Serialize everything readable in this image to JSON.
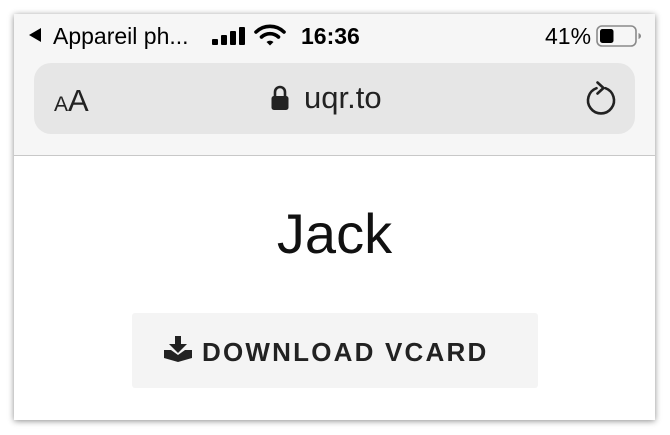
{
  "status_bar": {
    "carrier": "Appareil ph...",
    "time": "16:36",
    "battery_percent": "41%",
    "battery_level": 0.41
  },
  "browser": {
    "text_size_small": "A",
    "text_size_large": "A",
    "domain": "uqr.to"
  },
  "page": {
    "name": "Jack",
    "download_label": "DOWNLOAD VCARD"
  },
  "icons": {
    "back": "back-arrow-icon",
    "signal": "cellular-signal-icon",
    "wifi": "wifi-icon",
    "battery": "battery-icon",
    "lock": "lock-icon",
    "reload": "reload-icon",
    "download": "download-icon"
  },
  "colors": {
    "chrome_background": "#f6f6f6",
    "url_field": "#e6e6e6",
    "button_background": "#f4f4f4",
    "text": "#111111"
  }
}
